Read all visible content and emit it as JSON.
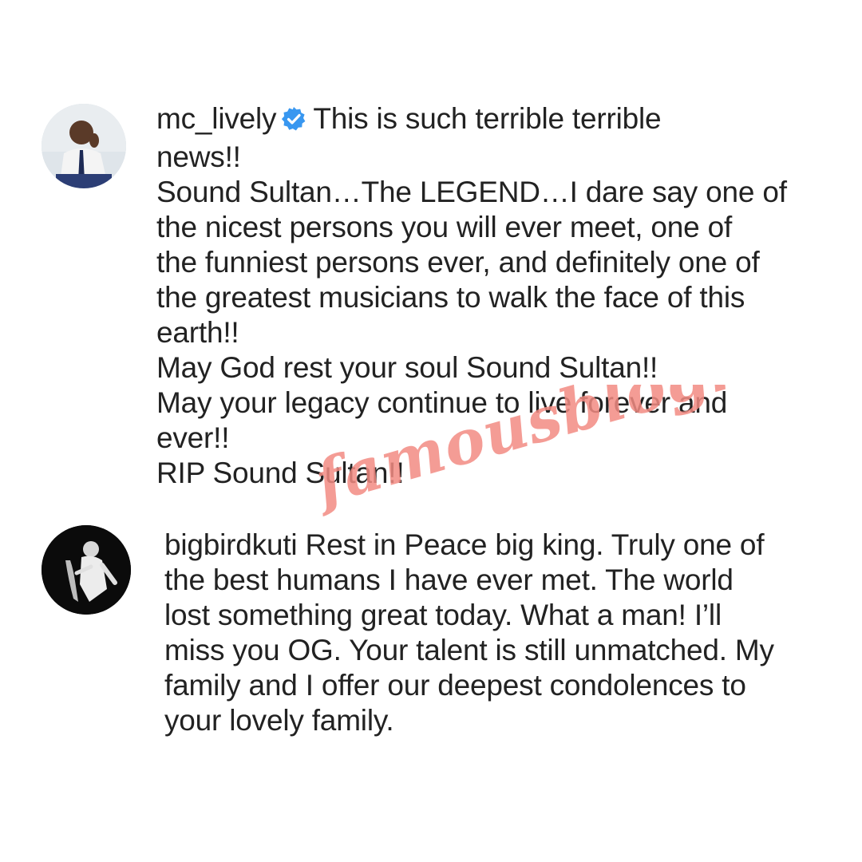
{
  "comments": [
    {
      "username": "mc_lively",
      "verified": true,
      "first_line_text": "This is such terrible terrible",
      "lines": [
        "news!!",
        "Sound Sultan…The LEGEND…I dare say one of",
        "the nicest persons you will ever meet, one of",
        "the funniest persons ever, and definitely one of",
        "the greatest musicians to walk the face of this",
        "earth!!",
        "May God rest your soul Sound Sultan!!",
        "May your legacy continue to live forever and",
        "ever!!",
        "RIP Sound Sultan!!"
      ]
    },
    {
      "username": "bigbirdkuti",
      "verified": false,
      "first_line_text": "Rest in Peace big king. Truly one of",
      "lines": [
        "the best humans I have ever met. The world",
        "lost something great today. What a man! I’ll",
        "miss you OG. Your talent is still unmatched. My",
        "family and I offer our deepest condolences to",
        "your lovely family."
      ]
    }
  ],
  "watermark": {
    "text": "famousblogng",
    "color": "#f28b82"
  },
  "colors": {
    "verified_badge": "#3897f0",
    "text": "#222222",
    "background": "#ffffff"
  }
}
